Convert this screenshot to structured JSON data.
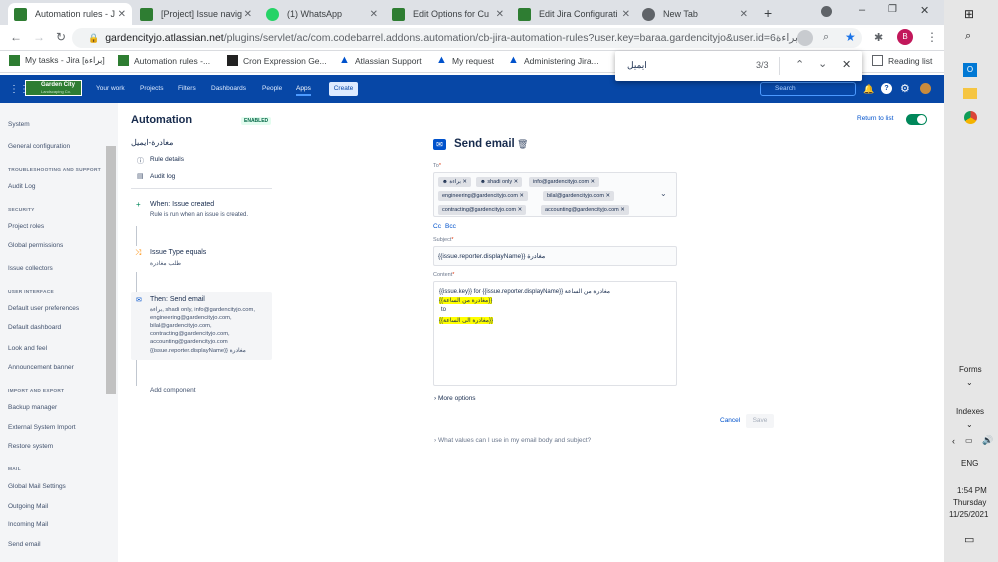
{
  "browser": {
    "tabs": [
      {
        "title": "Automation rules - J",
        "icon": "jira-icon",
        "active": true
      },
      {
        "title": "[Project] Issue navig",
        "icon": "jira-icon",
        "active": false
      },
      {
        "title": "(1) WhatsApp",
        "icon": "whatsapp-icon",
        "active": false
      },
      {
        "title": "Edit Options for Cu",
        "icon": "jira-icon",
        "active": false
      },
      {
        "title": "Edit Jira Configurati",
        "icon": "jira-icon",
        "active": false
      },
      {
        "title": "New Tab",
        "icon": "chrome-icon",
        "active": false
      }
    ],
    "url_host": "gardencityjo.atlassian.net",
    "url_path": "/plugins/servlet/ac/com.codebarrel.addons.automation/cb-jira-automation-rules?user.key=baraa.gardencityjo&user.id=6",
    "url_tail": "براءة",
    "bookmarks": [
      "My tasks - Jira [براءة]",
      "Automation rules -...",
      "Cron Expression Ge...",
      "Atlassian Support",
      "My request",
      "Administering Jira..."
    ],
    "reading_list": "Reading list",
    "profile_initial": "B"
  },
  "find": {
    "query": "ايميل",
    "count": "3/3"
  },
  "jira_nav": {
    "logo": "Garden City",
    "logo_sub": "Landscaping Co.",
    "items": [
      "Your work",
      "Projects",
      "Filters",
      "Dashboards",
      "People",
      "Apps"
    ],
    "create": "Create",
    "search_placeholder": "Search"
  },
  "sidebar": {
    "items_top": [
      "System",
      "General configuration"
    ],
    "sections": [
      {
        "heading": "TROUBLESHOOTING AND SUPPORT",
        "items": [
          "Audit Log"
        ]
      },
      {
        "heading": "SECURITY",
        "items": [
          "Project roles",
          "Global permissions",
          "Issue collectors"
        ]
      },
      {
        "heading": "USER INTERFACE",
        "items": [
          "Default user preferences",
          "Default dashboard",
          "Look and feel",
          "Announcement banner"
        ]
      },
      {
        "heading": "IMPORT AND EXPORT",
        "items": [
          "Backup manager",
          "External System Import",
          "Restore system"
        ]
      },
      {
        "heading": "MAIL",
        "items": [
          "Global Mail Settings",
          "Outgoing Mail",
          "Incoming Mail",
          "Send email"
        ]
      }
    ]
  },
  "automation": {
    "title": "Automation",
    "status": "ENABLED",
    "rule_name": "مغادرة-ايميل",
    "links": [
      "Rule details",
      "Audit log"
    ],
    "trigger": {
      "title": "When: Issue created",
      "desc": "Rule is run when an issue is created."
    },
    "condition": {
      "title": "Issue Type equals",
      "desc": "طلب مغادرة"
    },
    "action": {
      "title": "Then: Send email",
      "lines": [
        "براءة, shadi only, info@gardencityjo.com,",
        "engineering@gardencityjo.com,",
        "bilal@gardencityjo.com,",
        "contracting@gardencityjo.com,",
        "accounting@gardencityjo.com",
        "{{issue.reporter.displayName}} مغادرة"
      ]
    },
    "add_component": "Add component",
    "return": "Return to list"
  },
  "email": {
    "heading": "Send email",
    "to_label": "To",
    "recipients": [
      "براءة",
      "shadi only",
      "info@gardencityjo.com",
      "engineering@gardencityjo.com",
      "bilal@gardencityjo.com",
      "contracting@gardencityjo.com",
      "accounting@gardencityjo.com"
    ],
    "cc": "Cc",
    "bcc": "Bcc",
    "subject_label": "Subject",
    "subject_value": "{{issue.reporter.displayName}} مغادرة",
    "content_label": "Content",
    "content_lines": [
      "{{issue.key}} for {{issue.reporter.displayName}} مغادرة من الساعة",
      "{{مغادرة من الساعة}}",
      "to",
      "{{مغادرة الى الساعة}}"
    ],
    "more_options": "More options",
    "cancel": "Cancel",
    "save": "Save",
    "help": "What values can I use in my email body and subject?"
  },
  "taskbar": {
    "forms": "Forms",
    "indexes": "Indexes",
    "lang": "ENG",
    "time": "1:54 PM",
    "day": "Thursday",
    "date": "11/25/2021"
  }
}
